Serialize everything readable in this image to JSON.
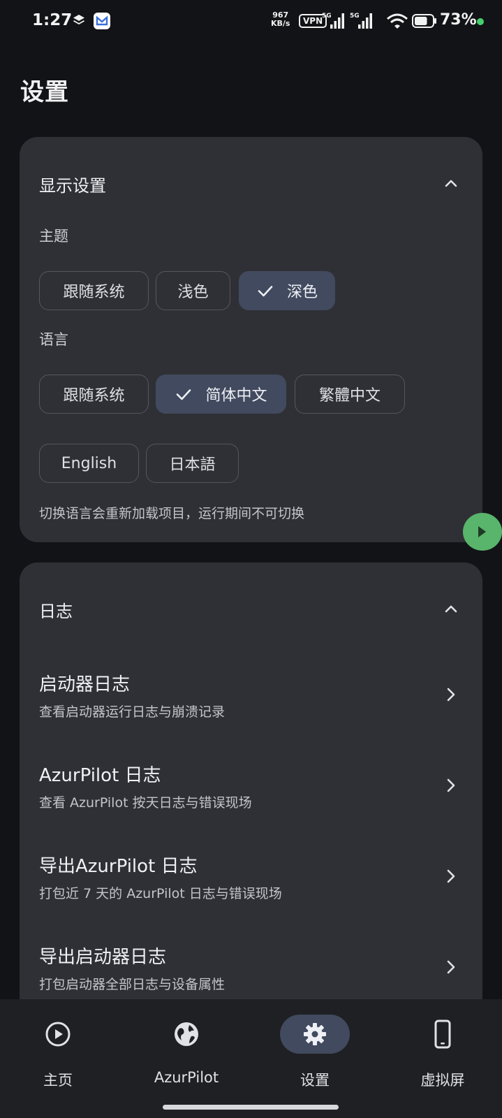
{
  "status_bar": {
    "time": "1:27",
    "net_speed_value": "967",
    "net_speed_unit": "KB/s",
    "vpn": "VPN",
    "signal_1": "5G",
    "signal_2": "5G",
    "battery": "73%",
    "battery_level": 0.73,
    "active_dot_color": "#43d16d"
  },
  "page": {
    "title": "设置"
  },
  "display_settings": {
    "title": "显示设置",
    "theme": {
      "label": "主题",
      "options": [
        "跟随系统",
        "浅色",
        "深色"
      ],
      "selected": "深色"
    },
    "language": {
      "label": "语言",
      "options": [
        "跟随系统",
        "简体中文",
        "繁體中文",
        "English",
        "日本語"
      ],
      "selected": "简体中文"
    },
    "hint": "切换语言会重新加载项目，运行期间不可切换"
  },
  "logs": {
    "title": "日志",
    "items": [
      {
        "title": "启动器日志",
        "subtitle": "查看启动器运行日志与崩溃记录"
      },
      {
        "title": "AzurPilot 日志",
        "subtitle": "查看 AzurPilot 按天日志与错误现场"
      },
      {
        "title": "导出AzurPilot 日志",
        "subtitle": "打包近 7 天的 AzurPilot 日志与错误现场"
      },
      {
        "title": "导出启动器日志",
        "subtitle": "打包启动器全部日志与设备属性"
      }
    ]
  },
  "bottom_nav": {
    "items": [
      {
        "label": "主页",
        "icon": "play-circle-icon"
      },
      {
        "label": "AzurPilot",
        "icon": "globe-icon"
      },
      {
        "label": "设置",
        "icon": "gear-icon"
      },
      {
        "label": "虚拟屏",
        "icon": "phone-icon"
      }
    ],
    "active": "设置"
  },
  "colors": {
    "background": "#121317",
    "card": "#2f3035",
    "selected_chip": "#414a5e",
    "fab": "#58b56b"
  }
}
